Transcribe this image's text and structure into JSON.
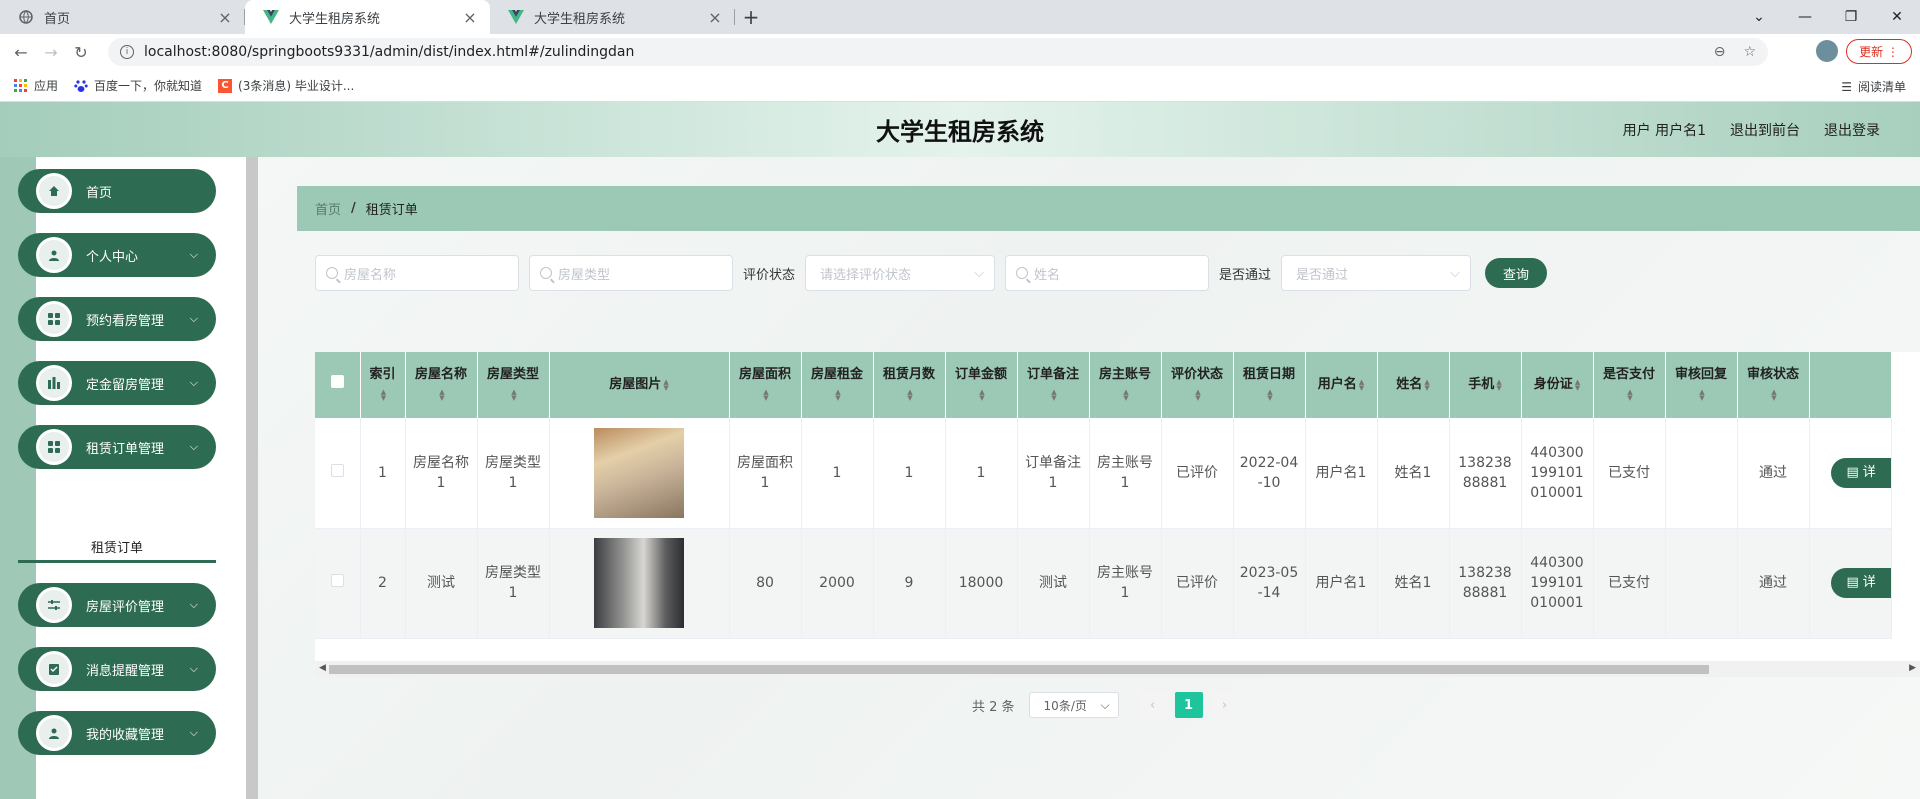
{
  "browser": {
    "tabs": [
      {
        "title": "首页",
        "active": false
      },
      {
        "title": "大学生租房系统",
        "active": true
      },
      {
        "title": "大学生租房系统",
        "active": false
      }
    ],
    "url": "localhost:8080/springboots9331/admin/dist/index.html#/zulindingdan",
    "update_label": "更新",
    "bookmarks": [
      "应用",
      "百度一下，你就知道",
      "(3条消息) 毕业设计..."
    ],
    "reading_list": "阅读清单"
  },
  "header": {
    "title": "大学生租房系统",
    "user_label": "用户 用户名1",
    "back_front": "退出到前台",
    "logout": "退出登录"
  },
  "sidebar": {
    "items": [
      {
        "label": "首页",
        "icon": "home-icon"
      },
      {
        "label": "个人中心",
        "icon": "user-icon"
      },
      {
        "label": "预约看房管理",
        "icon": "grid-icon"
      },
      {
        "label": "定金留房管理",
        "icon": "chart-icon"
      },
      {
        "label": "租赁订单管理",
        "icon": "grid-icon"
      },
      {
        "label": "房屋评价管理",
        "icon": "sliders-icon"
      },
      {
        "label": "消息提醒管理",
        "icon": "clipboard-icon"
      },
      {
        "label": "我的收藏管理",
        "icon": "user-icon"
      }
    ],
    "active_sub": "租赁订单"
  },
  "breadcrumb": {
    "home": "首页",
    "current": "租赁订单"
  },
  "filters": {
    "house_name_ph": "房屋名称",
    "house_type_ph": "房屋类型",
    "eval_label": "评价状态",
    "eval_ph": "请选择评价状态",
    "name_ph": "姓名",
    "pass_label": "是否通过",
    "pass_ph": "是否通过",
    "query": "查询"
  },
  "table": {
    "headers": [
      "索引",
      "房屋名称",
      "房屋类型",
      "房屋图片",
      "房屋面积",
      "房屋租金",
      "租赁月数",
      "订单金额",
      "订单备注",
      "房主账号",
      "评价状态",
      "租赁日期",
      "用户名",
      "姓名",
      "手机",
      "身份证",
      "是否支付",
      "审核回复",
      "审核状态"
    ],
    "rows": [
      [
        "1",
        "房屋名称1",
        "房屋类型1",
        "",
        "房屋面积1",
        "1",
        "1",
        "1",
        "订单备注1",
        "房主账号1",
        "已评价",
        "2022-04-10",
        "用户名1",
        "姓名1",
        "13823888881",
        "440300199101010001",
        "已支付",
        "",
        "通过"
      ],
      [
        "2",
        "测试",
        "房屋类型1",
        "",
        "80",
        "2000",
        "9",
        "18000",
        "测试",
        "房主账号1",
        "已评价",
        "2023-05-14",
        "用户名1",
        "姓名1",
        "13823888881",
        "440300199101010001",
        "已支付",
        "",
        "通过"
      ]
    ],
    "detail_label": "详"
  },
  "pagination": {
    "total": "共 2 条",
    "page_size": "10条/页",
    "current": "1"
  }
}
